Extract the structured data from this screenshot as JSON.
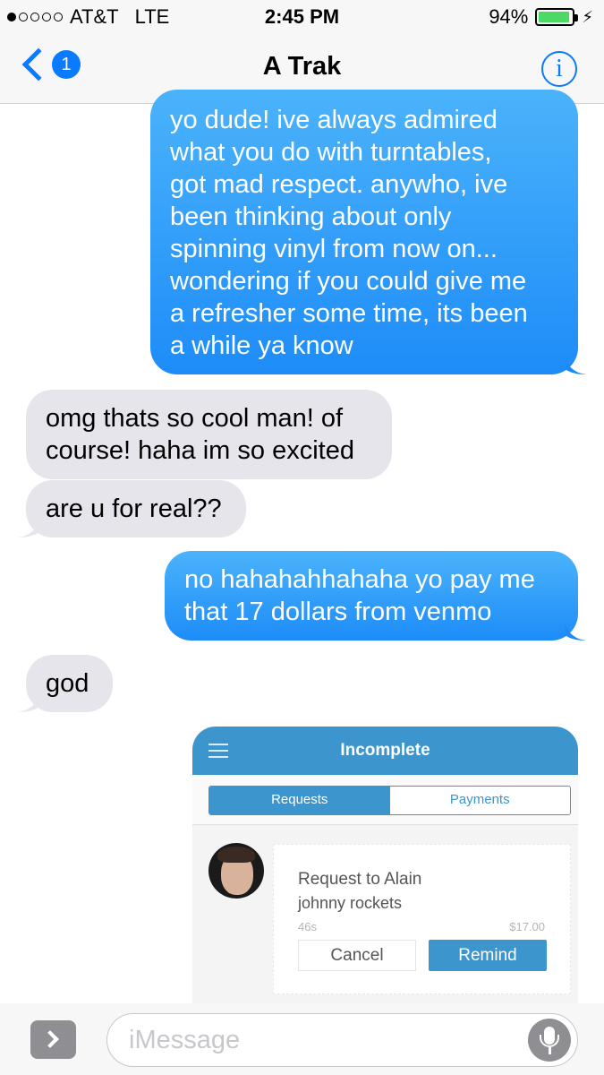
{
  "status_bar": {
    "carrier": "AT&T",
    "network": "LTE",
    "time": "2:45 PM",
    "battery_percent": "94%",
    "battery_level": 0.94,
    "signal_bars_filled": 1,
    "signal_bars_total": 5
  },
  "nav": {
    "back_badge": "1",
    "contact_name": "A Trak",
    "info_glyph": "i",
    "accent_color": "#0a7bff"
  },
  "messages": [
    {
      "direction": "outgoing",
      "text": "yo dude! ive always admired\nwhat you do with turntables,\ngot mad respect. anywho, ive\nbeen thinking about only\nspinning vinyl from now on...\nwondering if you could give me\na refresher some time, its been\na while ya know"
    },
    {
      "direction": "incoming",
      "text": "omg thats so cool man! of\ncourse! haha im so excited"
    },
    {
      "direction": "incoming",
      "text": "are u for real??"
    },
    {
      "direction": "outgoing",
      "text": "no hahahahhahaha yo pay me\nthat 17 dollars from venmo"
    },
    {
      "direction": "incoming",
      "text": "god"
    }
  ],
  "venmo": {
    "title": "Incomplete",
    "tabs": [
      "Requests",
      "Payments"
    ],
    "active_tab": "Requests",
    "request": {
      "title": "Request to Alain",
      "note": "johnny rockets",
      "time": "46s",
      "amount": "$17.00",
      "cancel_label": "Cancel",
      "remind_label": "Remind"
    },
    "brand_color": "#3d95ce"
  },
  "input_bar": {
    "placeholder": "iMessage"
  },
  "icons": {
    "back": "chevron-left-icon",
    "info": "info-icon",
    "menu": "hamburger-menu-icon",
    "apps": "chevron-right-icon",
    "mic": "microphone-icon"
  }
}
